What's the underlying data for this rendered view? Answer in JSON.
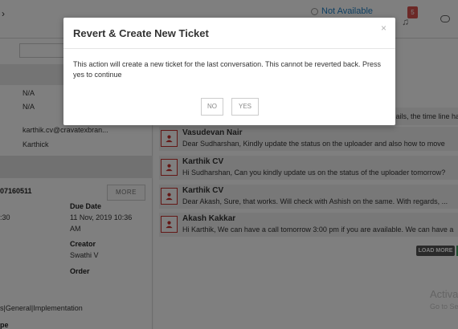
{
  "header": {
    "status_text": "Not Available",
    "notification_count": "5"
  },
  "left_panel": {
    "field_values": [
      "N/A",
      "N/A",
      "karthik.cv@cravatexbran...",
      "Karthick"
    ],
    "ticket_number": "07160511",
    "more_label": "MORE",
    "time_partial": ":30",
    "due_date_label": "Due Date",
    "due_date_value_line1": "11 Nov, 2019 10:36",
    "due_date_value_line2": "AM",
    "creator_label": "Creator",
    "creator_value": "Swathi V",
    "order_label": "Order",
    "category_text": "s|General|Implementation",
    "type_partial": "pe"
  },
  "conversation": {
    "top_message_tail": "ails, the time line ha",
    "messages": [
      {
        "name": "Vasudevan Nair",
        "text": "Dear Sudharshan,  Kindly update the status on the uploader and also how to move"
      },
      {
        "name": "Karthik CV",
        "text": "Hi Sudharshan, Can you kindly update us on the status of the uploader tomorrow?"
      },
      {
        "name": "Karthik CV",
        "text": "Dear Akash, Sure, that works. Will check with Ashish on the same. With regards, ..."
      },
      {
        "name": "Akash Kakkar",
        "text": "Hi Karthik, We can have a call tomorrow 3:00 pm if you are available. We can have a"
      }
    ],
    "load_more_label": "LOAD MORE"
  },
  "watermark": {
    "line1": "Activa",
    "line2": "Go to Se"
  },
  "modal": {
    "title": "Revert & Create New Ticket",
    "close_symbol": "×",
    "body": "This action will create a new ticket for the last conversation. This cannot be reverted back. Press yes to continue",
    "no_label": "NO",
    "yes_label": "YES"
  },
  "colors": {
    "accent_red": "#c9302c",
    "status_blue": "#1f7fc4",
    "badge_red": "#d9534f"
  }
}
